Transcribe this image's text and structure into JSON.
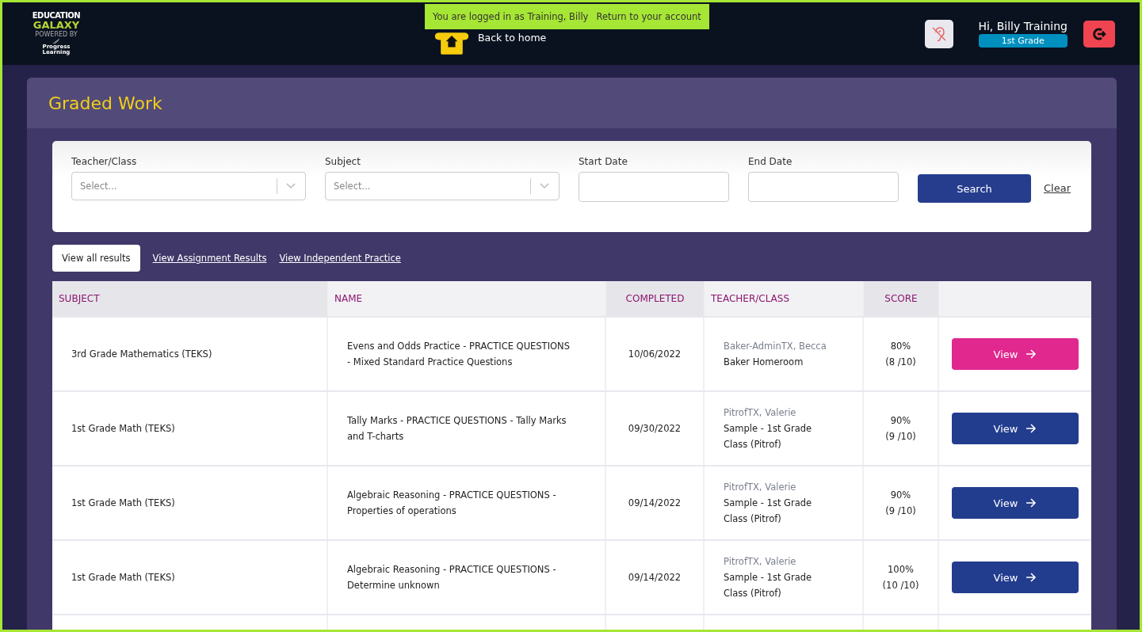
{
  "logo": {
    "line_1": "EDUCATION",
    "line_2": "GALAXY",
    "powered_by": "POWERED BY",
    "partner_1": "Progress",
    "partner_2": "Learning"
  },
  "impersonation_banner": {
    "text": "You are logged in as Training,  Billy",
    "link": "Return to your account"
  },
  "home_link": "Back to home",
  "user": {
    "greeting": "Hi,  Billy Training",
    "grade": "1st Grade"
  },
  "page_title": "Graded Work",
  "filters": [
    {
      "label": "Teacher/Class",
      "kind": "select",
      "placeholder": "Select..."
    },
    {
      "label": "Subject",
      "kind": "select",
      "placeholder": "Select..."
    },
    {
      "label": "Start Date",
      "kind": "date"
    },
    {
      "label": "End Date",
      "kind": "date"
    }
  ],
  "search_button": "Search",
  "clear_link": "Clear",
  "view_tabs": [
    {
      "label": "View all results",
      "selected": true
    },
    {
      "label": "View  Assignment  Results",
      "selected": false
    },
    {
      "label": "View  Independent  Practice",
      "selected": false
    }
  ],
  "table": {
    "columns": [
      "SUBJECT",
      "NAME",
      "COMPLETED",
      "TEACHER/CLASS",
      "SCORE"
    ],
    "rows": [
      {
        "subject": "3rd Grade  Mathematics (TEKS)",
        "name": "Evens and Odds  Practice -  PRACTICE QUESTIONS -  Mixed Standard  Practice Questions",
        "completed": "10/06/2022",
        "teacher": "Baker-AdminTX,  Becca",
        "class": "Baker  Homeroom",
        "percent": "80%",
        "points": "(8 /10)",
        "button": "View",
        "selected": true
      },
      {
        "subject": "1st Grade  Math (TEKS)",
        "name": "Tally  Marks -  PRACTICE QUESTIONS - Tally Marks and T-charts",
        "completed": "09/30/2022",
        "teacher": "PitrofTX, Valerie",
        "class": "Sample - 1st Grade Class (Pitrof)",
        "percent": "90%",
        "points": "(9 /10)",
        "button": "View",
        "selected": false
      },
      {
        "subject": "1st Grade  Math (TEKS)",
        "name": "Algebraic  Reasoning -  PRACTICE QUESTIONS - Properties of operations",
        "completed": "09/14/2022",
        "teacher": "PitrofTX, Valerie",
        "class": "Sample - 1st Grade Class (Pitrof)",
        "percent": "90%",
        "points": "(9 /10)",
        "button": "View",
        "selected": false
      },
      {
        "subject": "1st Grade  Math (TEKS)",
        "name": "Algebraic  Reasoning -  PRACTICE QUESTIONS - Determine unknown",
        "completed": "09/14/2022",
        "teacher": "PitrofTX, Valerie",
        "class": "Sample - 1st Grade Class (Pitrof)",
        "percent": "100%",
        "points": "(10 /10)",
        "button": "View",
        "selected": false
      }
    ]
  }
}
